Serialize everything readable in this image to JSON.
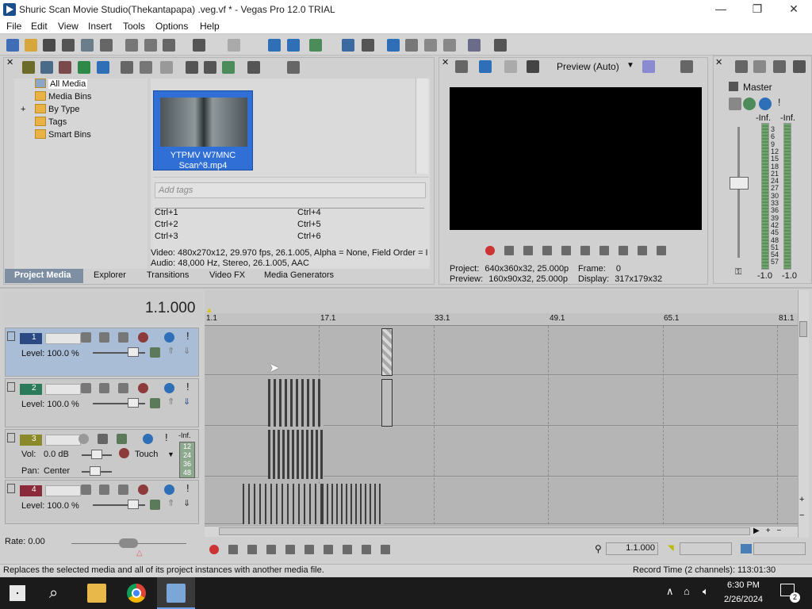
{
  "window": {
    "title": "Shuric Scan Movie Studio(Thekantapapa) .veg.vf * - Vegas Pro 12.0 TRIAL",
    "minimize": "—",
    "maximize": "❐",
    "close": "✕"
  },
  "menu": [
    "File",
    "Edit",
    "View",
    "Insert",
    "Tools",
    "Options",
    "Help"
  ],
  "tree": [
    {
      "label": "All Media"
    },
    {
      "label": "Media Bins"
    },
    {
      "label": "By Type",
      "expand": "+"
    },
    {
      "label": "Tags"
    },
    {
      "label": "Smart Bins"
    }
  ],
  "media": {
    "item": {
      "name": "YTPMV W7MNC Scan^8.mp4"
    },
    "tags_placeholder": "Add tags",
    "shortcuts": [
      "Ctrl+1",
      "Ctrl+2",
      "Ctrl+3",
      "Ctrl+4",
      "Ctrl+5",
      "Ctrl+6"
    ],
    "video_info": "Video: 480x270x12, 29.970 fps, 26.1.005, Alpha = None, Field Order = I",
    "audio_info": "Audio: 48,000 Hz, Stereo, 26.1.005, AAC"
  },
  "panel_tabs": [
    "Project Media",
    "Explorer",
    "Transitions",
    "Video FX",
    "Media Generators"
  ],
  "preview": {
    "mode": "Preview (Auto)",
    "project_label": "Project:",
    "project": "640x360x32, 25.000p",
    "preview_label": "Preview:",
    "preview": "160x90x32, 25.000p",
    "frame_label": "Frame:",
    "frame": "0",
    "display_label": "Display:",
    "display": "317x179x32"
  },
  "mixer": {
    "title": "Master",
    "left_inf": "-Inf.",
    "right_inf": "-Inf.",
    "scale": [
      "3",
      "6",
      "9",
      "12",
      "15",
      "18",
      "21",
      "24",
      "27",
      "30",
      "33",
      "36",
      "39",
      "42",
      "45",
      "48",
      "51",
      "54",
      "57"
    ],
    "left_bottom": "-1.0",
    "right_bottom": "-1.0"
  },
  "timeline": {
    "position": "1.1.000",
    "ruler": [
      "1.1",
      "17.1",
      "33.1",
      "49.1",
      "65.1",
      "81.1"
    ],
    "rate": "Rate: 0.00",
    "cursor_time": "1.1.000"
  },
  "tracks": [
    {
      "num": "1",
      "type": "video",
      "level": "Level: 100.0 %",
      "color": "#2b4a83",
      "selected": true
    },
    {
      "num": "2",
      "type": "video",
      "level": "Level: 100.0 %",
      "color": "#2b7a5a",
      "selected": false
    },
    {
      "num": "3",
      "type": "audio",
      "vol_label": "Vol:",
      "vol": "0.0 dB",
      "pan_label": "Pan:",
      "pan": "Center",
      "touch": "Touch",
      "meter_inf": "-Inf.",
      "meter_scale": [
        "12",
        "24",
        "36",
        "48"
      ],
      "color": "#8a8a2a",
      "selected": false
    },
    {
      "num": "4",
      "type": "video",
      "level": "Level: 100.0 %",
      "color": "#8a2a3a",
      "selected": false
    }
  ],
  "status": {
    "message": "Replaces the selected media and all of its project instances with another media file.",
    "record_time": "Record Time (2 channels): 113:01:30"
  },
  "taskbar": {
    "time": "6:30 PM",
    "date": "2/26/2024",
    "notification_count": "2"
  }
}
